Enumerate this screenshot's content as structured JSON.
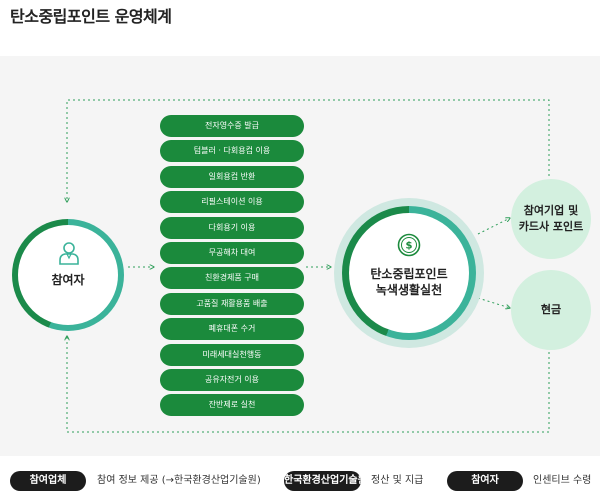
{
  "title": "탄소중립포인트 운영체계",
  "participant": {
    "label": "참여자",
    "icon": "person-icon"
  },
  "activities": [
    "전자영수증 발급",
    "텀블러 · 다회용컵 이용",
    "일회용컵 반환",
    "리필스테이션 이용",
    "다회용기 이용",
    "무공해차 대여",
    "친환경제품 구매",
    "고품질 재활용품 배출",
    "폐휴대폰 수거",
    "미래세대실천행동",
    "공유자전거 이용",
    "잔반제로 실천"
  ],
  "center": {
    "line1": "탄소중립포인트",
    "line2": "녹색생활실천",
    "icon": "dollar-coin-icon"
  },
  "benefits": {
    "top_line1": "참여기업 및",
    "top_line2": "카드사 포인트",
    "bottom": "현금"
  },
  "legend": [
    {
      "pill": "참여업체",
      "text": "참여 정보 제공 (→한국환경산업기술원)"
    },
    {
      "pill": "한국환경산업기술원",
      "text": "정산 및 지급"
    },
    {
      "pill": "참여자",
      "text": "인센티브 수령"
    }
  ],
  "colors": {
    "dark_green": "#1b8a3c",
    "teal": "#3bb39a",
    "light_green": "#d3f0df",
    "dotted_line": "#2f9e5a",
    "pill": "#1c1c1c"
  }
}
